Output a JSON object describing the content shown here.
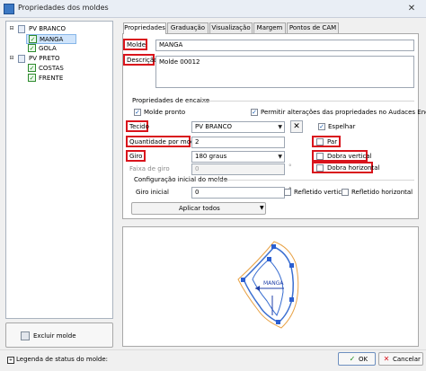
{
  "window": {
    "title": "Propriedades dos moldes",
    "close_glyph": "✕"
  },
  "tree": {
    "groups": [
      {
        "label": "PV BRANCO",
        "items": [
          "MANGA",
          "GOLA"
        ]
      },
      {
        "label": "PV PRETO",
        "items": [
          "COSTAS",
          "FRENTE"
        ]
      }
    ],
    "expand_glyph": "⊟",
    "check_glyph": "✓",
    "selected": "MANGA"
  },
  "delete_button": {
    "label": "Excluir molde"
  },
  "status": {
    "legend_label": "Legenda de status do molde:",
    "legend_glyph": "+"
  },
  "tabs": [
    "Propriedades",
    "Graduação",
    "Visualização",
    "Margem",
    "Pontos de CAM"
  ],
  "active_tab": "Propriedades",
  "form": {
    "molde_label": "Molde",
    "molde_value": "MANGA",
    "descricao_label": "Descrição",
    "descricao_value": "Molde 00012",
    "encaixe_section": "Propriedades de encaixe",
    "molde_pronto": "Molde pronto",
    "permitir": "Permitir alterações das propriedades no Audaces Encaixe",
    "tecido_label": "Tecido",
    "tecido_value": "PV BRANCO",
    "espelhar": "Espelhar",
    "quantidade_label": "Quantidade por modelo",
    "quantidade_value": "2",
    "par": "Par",
    "giro_label": "Giro",
    "giro_value": "180 graus",
    "dobra_vertical": "Dobra vertical",
    "faixa_label": "Faixa de giro",
    "faixa_value": "0",
    "degree_symbol": "°",
    "dobra_horizontal": "Dobra horizontal",
    "config_section": "Configuração inicial do molde",
    "giro_inicial_label": "Giro inicial",
    "giro_inicial_value": "0",
    "refletido_vertical": "Refletido vertical",
    "refletido_horizontal": "Refletido horizontal",
    "aplicar_label": "Aplicar todos",
    "dropdown_glyph": "▼",
    "check_glyph": "✓"
  },
  "preview": {
    "piece_label": "MANGA"
  },
  "footer": {
    "ok_label": "OK",
    "ok_glyph": "✓",
    "cancel_label": "Cancelar",
    "cancel_glyph": "✕"
  },
  "colors": {
    "highlight": "#d9141c",
    "accent": "#3b78c4",
    "check_green": "#1c8c1c"
  }
}
